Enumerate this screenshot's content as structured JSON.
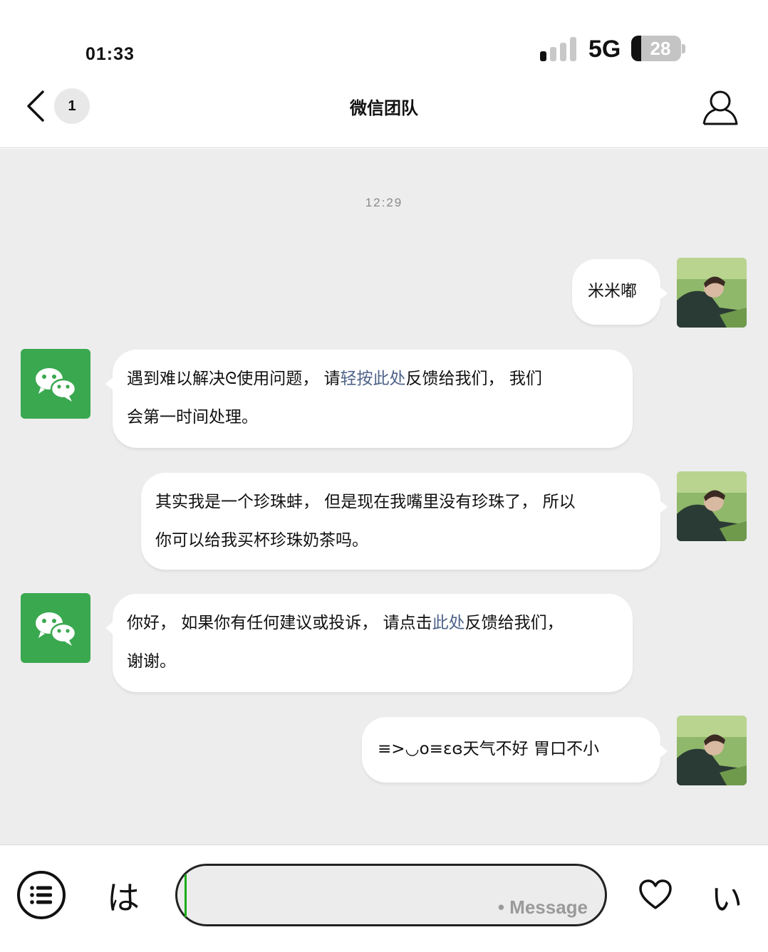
{
  "status_bar": {
    "time": "01:33",
    "network": "5G",
    "battery": "28"
  },
  "nav": {
    "unread_count": "1",
    "title": "微信团队"
  },
  "chat": {
    "timestamp": "12:29",
    "messages": [
      {
        "side": "right",
        "line1": "米米嘟"
      },
      {
        "side": "left",
        "line1_a": "遇到难以解决ᘓ使用问题， 请",
        "line1_link": "轻按此处",
        "line1_b": "反馈给我们，  我们",
        "line2": "会第一时间处理。"
      },
      {
        "side": "right",
        "line1": "其实我是一个珍珠蚌， 但是现在我嘴里没有珍珠了， 所以",
        "line2": "你可以给我买杯珍珠奶茶吗。"
      },
      {
        "side": "left",
        "line1_a": "你好，  如果你有任何建议或投诉，  请点击",
        "line1_link": "此处",
        "line1_b": "反馈给我们，",
        "line2": "谢谢。"
      },
      {
        "side": "right",
        "line1": "≡>◡o≡ɛɞ天气不好  胃口不小"
      }
    ]
  },
  "input_bar": {
    "left_key": "は",
    "placeholder": "• Message",
    "right_key": "い"
  },
  "colors": {
    "wechat_green": "#3aa84f",
    "link": "#4f6389",
    "chat_bg": "#ededed"
  },
  "icons": [
    "chevron-left-icon",
    "person-icon",
    "wechat-logo-icon",
    "list-icon",
    "heart-icon"
  ]
}
